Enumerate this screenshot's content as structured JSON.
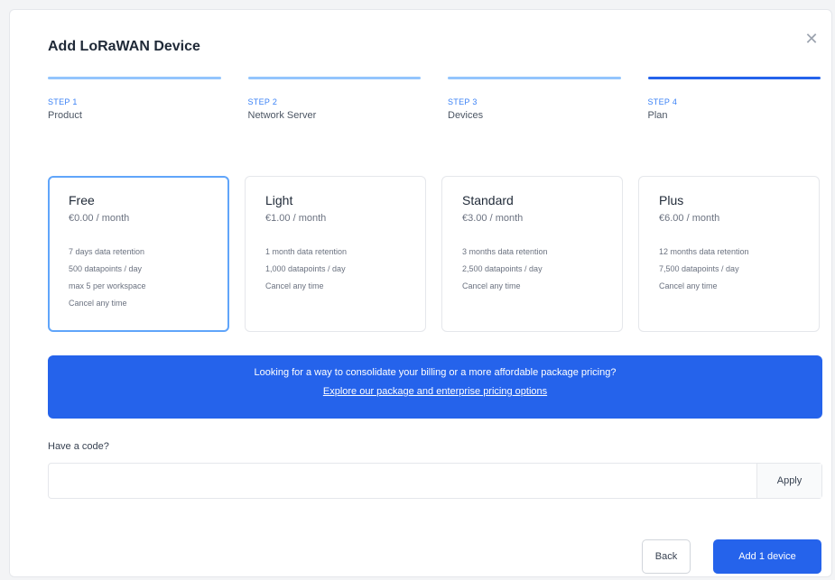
{
  "dialog": {
    "title": "Add LoRaWAN Device",
    "close_icon": "close-icon"
  },
  "steps": [
    {
      "label": "STEP 1",
      "name": "Product",
      "status": "complete"
    },
    {
      "label": "STEP 2",
      "name": "Network Server",
      "status": "complete"
    },
    {
      "label": "STEP 3",
      "name": "Devices",
      "status": "complete"
    },
    {
      "label": "STEP 4",
      "name": "Plan",
      "status": "active"
    }
  ],
  "plans": [
    {
      "name": "Free",
      "price": "€0.00 / month",
      "features": [
        "7 days data retention",
        "500 datapoints / day",
        "max 5 per workspace",
        "Cancel any time"
      ],
      "selected": true
    },
    {
      "name": "Light",
      "price": "€1.00 / month",
      "features": [
        "1 month data retention",
        "1,000 datapoints / day",
        "Cancel any time"
      ],
      "selected": false
    },
    {
      "name": "Standard",
      "price": "€3.00 / month",
      "features": [
        "3 months data retention",
        "2,500 datapoints / day",
        "Cancel any time"
      ],
      "selected": false
    },
    {
      "name": "Plus",
      "price": "€6.00 / month",
      "features": [
        "12 months data retention",
        "7,500 datapoints / day",
        "Cancel any time"
      ],
      "selected": false
    }
  ],
  "banner": {
    "text": "Looking for a way to consolidate your billing or a more affordable package pricing?",
    "link": "Explore our package and enterprise pricing options"
  },
  "code": {
    "label": "Have a code?",
    "value": "",
    "apply_label": "Apply"
  },
  "footer": {
    "back_label": "Back",
    "add_label": "Add 1 device"
  },
  "colors": {
    "accent": "#2563eb",
    "step_complete": "#93c5fd",
    "selected_border": "#60a5fa"
  }
}
